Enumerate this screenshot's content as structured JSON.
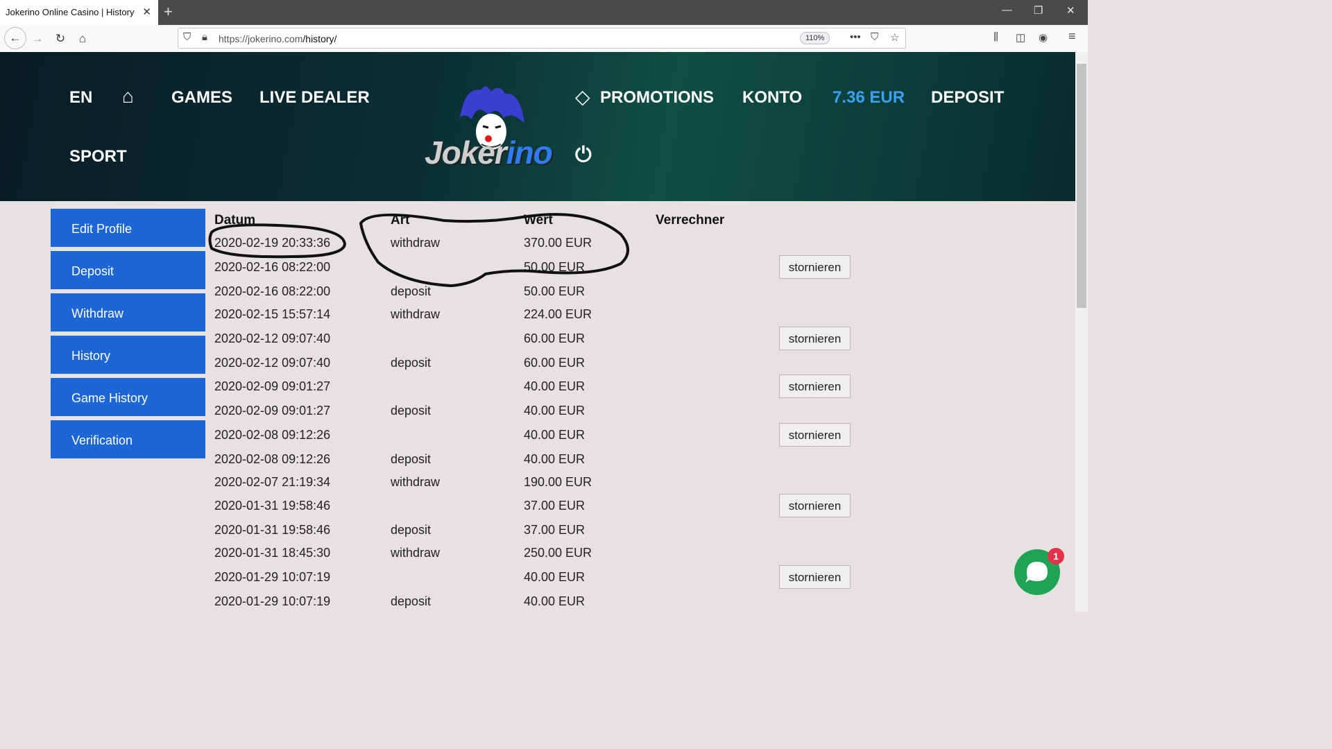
{
  "browser": {
    "tab_title": "Jokerino Online Casino | History",
    "tab_close": "✕",
    "new_tab": "+",
    "url_scheme_host": "https://jokerino.com",
    "url_path": "/history/",
    "zoom": "110%",
    "more_icon": "•••",
    "pocket_icon": "⛉",
    "star_icon": "☆",
    "back_icon": "←",
    "forward_icon": "→",
    "reload_icon": "↻",
    "home_icon": "⌂",
    "library_icon": "⫼",
    "sidebar_icon": "◫",
    "account_icon": "◉",
    "menu_icon": "≡",
    "minimize": "—",
    "restore": "❐",
    "close": "✕"
  },
  "header": {
    "nav_en": "EN",
    "nav_home_icon": "⌂",
    "nav_games": "GAMES",
    "nav_live": "LIVE DEALER",
    "nav_promotions": "PROMOTIONS",
    "promo_icon": "◇",
    "nav_konto": "KONTO",
    "nav_balance": "7.36 EUR",
    "nav_deposit": "DEPOSIT",
    "nav_sport": "SPORT",
    "logo_text_a": "Joker",
    "logo_text_b": "ino",
    "power_icon": "⏻"
  },
  "sidebar": {
    "items": [
      {
        "label": "Edit Profile"
      },
      {
        "label": "Deposit"
      },
      {
        "label": "Withdraw"
      },
      {
        "label": "History"
      },
      {
        "label": "Game History"
      },
      {
        "label": "Verification"
      }
    ]
  },
  "table": {
    "headers": {
      "datum": "Datum",
      "art": "Art",
      "wert": "Wert",
      "verrechner": "Verrechner"
    },
    "cancel_label": "stornieren",
    "rows": [
      {
        "datum": "2020-02-19 20:33:36",
        "art": "withdraw",
        "wert": "370.00 EUR",
        "cancel": false
      },
      {
        "datum": "2020-02-16 08:22:00",
        "art": "",
        "wert": "50.00 EUR",
        "cancel": true
      },
      {
        "datum": "2020-02-16 08:22:00",
        "art": "deposit",
        "wert": "50.00 EUR",
        "cancel": false
      },
      {
        "datum": "2020-02-15 15:57:14",
        "art": "withdraw",
        "wert": "224.00 EUR",
        "cancel": false
      },
      {
        "datum": "2020-02-12 09:07:40",
        "art": "",
        "wert": "60.00 EUR",
        "cancel": true
      },
      {
        "datum": "2020-02-12 09:07:40",
        "art": "deposit",
        "wert": "60.00 EUR",
        "cancel": false
      },
      {
        "datum": "2020-02-09 09:01:27",
        "art": "",
        "wert": "40.00 EUR",
        "cancel": true
      },
      {
        "datum": "2020-02-09 09:01:27",
        "art": "deposit",
        "wert": "40.00 EUR",
        "cancel": false
      },
      {
        "datum": "2020-02-08 09:12:26",
        "art": "",
        "wert": "40.00 EUR",
        "cancel": true
      },
      {
        "datum": "2020-02-08 09:12:26",
        "art": "deposit",
        "wert": "40.00 EUR",
        "cancel": false
      },
      {
        "datum": "2020-02-07 21:19:34",
        "art": "withdraw",
        "wert": "190.00 EUR",
        "cancel": false
      },
      {
        "datum": "2020-01-31 19:58:46",
        "art": "",
        "wert": "37.00 EUR",
        "cancel": true
      },
      {
        "datum": "2020-01-31 19:58:46",
        "art": "deposit",
        "wert": "37.00 EUR",
        "cancel": false
      },
      {
        "datum": "2020-01-31 18:45:30",
        "art": "withdraw",
        "wert": "250.00 EUR",
        "cancel": false
      },
      {
        "datum": "2020-01-29 10:07:19",
        "art": "",
        "wert": "40.00 EUR",
        "cancel": true
      },
      {
        "datum": "2020-01-29 10:07:19",
        "art": "deposit",
        "wert": "40.00 EUR",
        "cancel": false
      }
    ]
  },
  "chat": {
    "badge": "1"
  }
}
